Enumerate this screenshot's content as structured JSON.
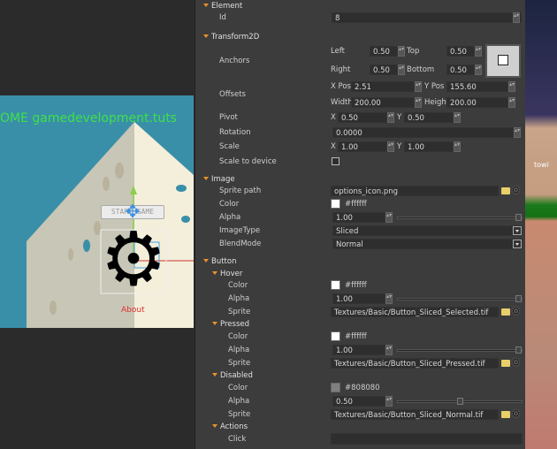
{
  "viewport": {
    "title_text": "OME gamedevelopment.tuts",
    "start_button": "START GAME",
    "about_link": "About"
  },
  "scene": {
    "label": "towi"
  },
  "element": {
    "header": "Element",
    "id_label": "Id",
    "id_value": "8"
  },
  "transform": {
    "header": "Transform2D",
    "anchors_label": "Anchors",
    "left_label": "Left",
    "left": "0.50",
    "top_label": "Top",
    "top": "0.50",
    "right_label": "Right",
    "right": "0.50",
    "bottom_label": "Bottom",
    "bottom": "0.50",
    "offsets_label": "Offsets",
    "xpos_label": "X Pos",
    "xpos": "2.51",
    "ypos_label": "Y Pos",
    "ypos": "155.60",
    "width_label": "Width",
    "width": "200.00",
    "height_label": "Height",
    "height": "200.00",
    "pivot_label": "Pivot",
    "pivot_x": "0.50",
    "pivot_y": "0.50",
    "x_label": "X",
    "y_label": "Y",
    "rotation_label": "Rotation",
    "rotation": "0.0000",
    "scale_label": "Scale",
    "scale_x": "1.00",
    "scale_y": "1.00",
    "scale_device_label": "Scale to device",
    "scale_device": false
  },
  "image": {
    "header": "Image",
    "sprite_label": "Sprite path",
    "sprite": "options_icon.png",
    "color_label": "Color",
    "color": "#ffffff",
    "alpha_label": "Alpha",
    "alpha": "1.00",
    "alpha_fraction": 1.0,
    "type_label": "ImageType",
    "type": "Sliced",
    "blend_label": "BlendMode",
    "blend": "Normal"
  },
  "button": {
    "header": "Button",
    "hover": {
      "header": "Hover",
      "color_label": "Color",
      "color": "#ffffff",
      "alpha_label": "Alpha",
      "alpha": "1.00",
      "alpha_fraction": 1.0,
      "sprite_label": "Sprite",
      "sprite": "Textures/Basic/Button_Sliced_Selected.tif"
    },
    "pressed": {
      "header": "Pressed",
      "color_label": "Color",
      "color": "#ffffff",
      "alpha_label": "Alpha",
      "alpha": "1.00",
      "alpha_fraction": 1.0,
      "sprite_label": "Sprite",
      "sprite": "Textures/Basic/Button_Sliced_Pressed.tif"
    },
    "disabled": {
      "header": "Disabled",
      "color_label": "Color",
      "color": "#808080",
      "alpha_label": "Alpha",
      "alpha": "0.50",
      "alpha_fraction": 0.5,
      "sprite_label": "Sprite",
      "sprite": "Textures/Basic/Button_Sliced_Normal.tif"
    },
    "actions": {
      "header": "Actions",
      "click_label": "Click",
      "click": ""
    }
  },
  "colors": {
    "accent": "#e8922a",
    "panel": "#3c3c3c",
    "title_green": "#3ee04a",
    "about_red": "#e03030"
  }
}
